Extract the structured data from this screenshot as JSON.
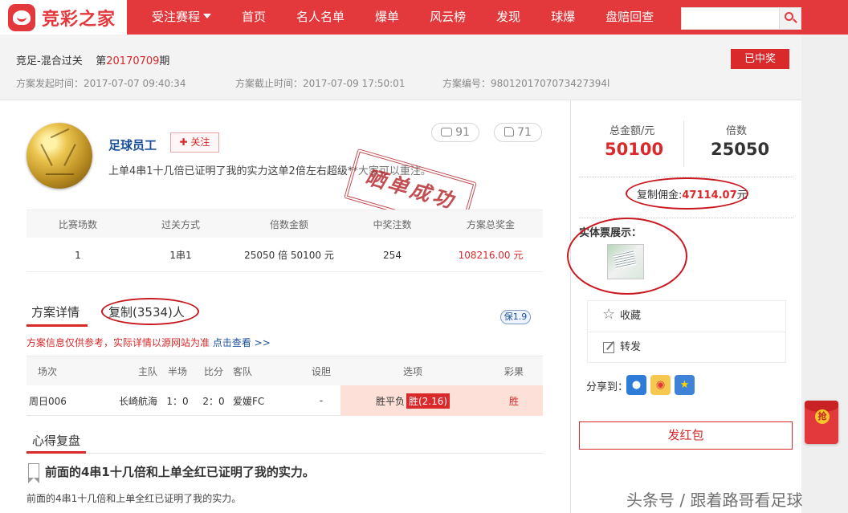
{
  "brand": {
    "name": "竞彩之家",
    "accent": "#e4393c"
  },
  "nav": [
    "受注赛程",
    "首页",
    "名人名单",
    "爆单",
    "风云榜",
    "发现",
    "球爆",
    "盘赔回查"
  ],
  "search": {
    "placeholder": ""
  },
  "plan": {
    "issue_prefix": "竞足-混合过关",
    "issue_label": "第",
    "issue_no": "20170709",
    "issue_suffix": "期",
    "status": "已中奖",
    "start_time": "方案发起时间：2017-07-07 09:40:34",
    "end_time": "方案截止时间：2017-07-09 17:50:01",
    "plan_no": "方案编号：9801201707073427394l"
  },
  "author": {
    "name": "足球员工",
    "follow": "关注",
    "comments": "91",
    "likes": "71",
    "description": "上单4串1十几倍已证明了我的实力这单2倍左右超级**大家可以重注。"
  },
  "stamp": "晒单成功",
  "stats": {
    "headers": [
      "比赛场数",
      "过关方式",
      "倍数金额",
      "中奖注数",
      "方案总奖金"
    ],
    "values": [
      "1",
      "1串1",
      "25050 倍   50100 元",
      "254",
      "108216.00 元"
    ]
  },
  "tabs": {
    "detail": "方案详情",
    "copy": "复制(3534)人",
    "insurance": "保1.9"
  },
  "tip": {
    "text": "方案信息仅供参考，实际详情以源网站为准 ",
    "link": "点击查看 >>"
  },
  "match": {
    "headers": [
      "场次",
      "主队",
      "半场",
      "比分",
      "客队",
      "设胆",
      "选项",
      "彩果"
    ],
    "row": {
      "id": "周日006",
      "home": "长崎航海",
      "half": "1：0",
      "score": "2：0",
      "away": "爱媛FC",
      "banker": "-",
      "options": "胜平负",
      "pick": "胜(2.16)",
      "result": "胜"
    }
  },
  "review": {
    "title": "心得复盘",
    "article_title": "前面的4串1十几倍和上单全红已证明了我的实力。",
    "article_text": "前面的4串1十几倍和上单全红已证明了我的实力。"
  },
  "summary": {
    "total_label": "总金额/元",
    "total": "50100",
    "multiple_label": "倍数",
    "multiple": "25050",
    "commission_label": "复制佣金:",
    "commission": "47114.07",
    "commission_unit": "元"
  },
  "ticket": {
    "title": "实体票展示："
  },
  "actions": {
    "favorite": "收藏",
    "forward": "转发",
    "share_to": "分享到："
  },
  "redpacket": "发红包",
  "float_redpacket": "抢",
  "watermark": "头条号 / 跟着路哥看足球"
}
